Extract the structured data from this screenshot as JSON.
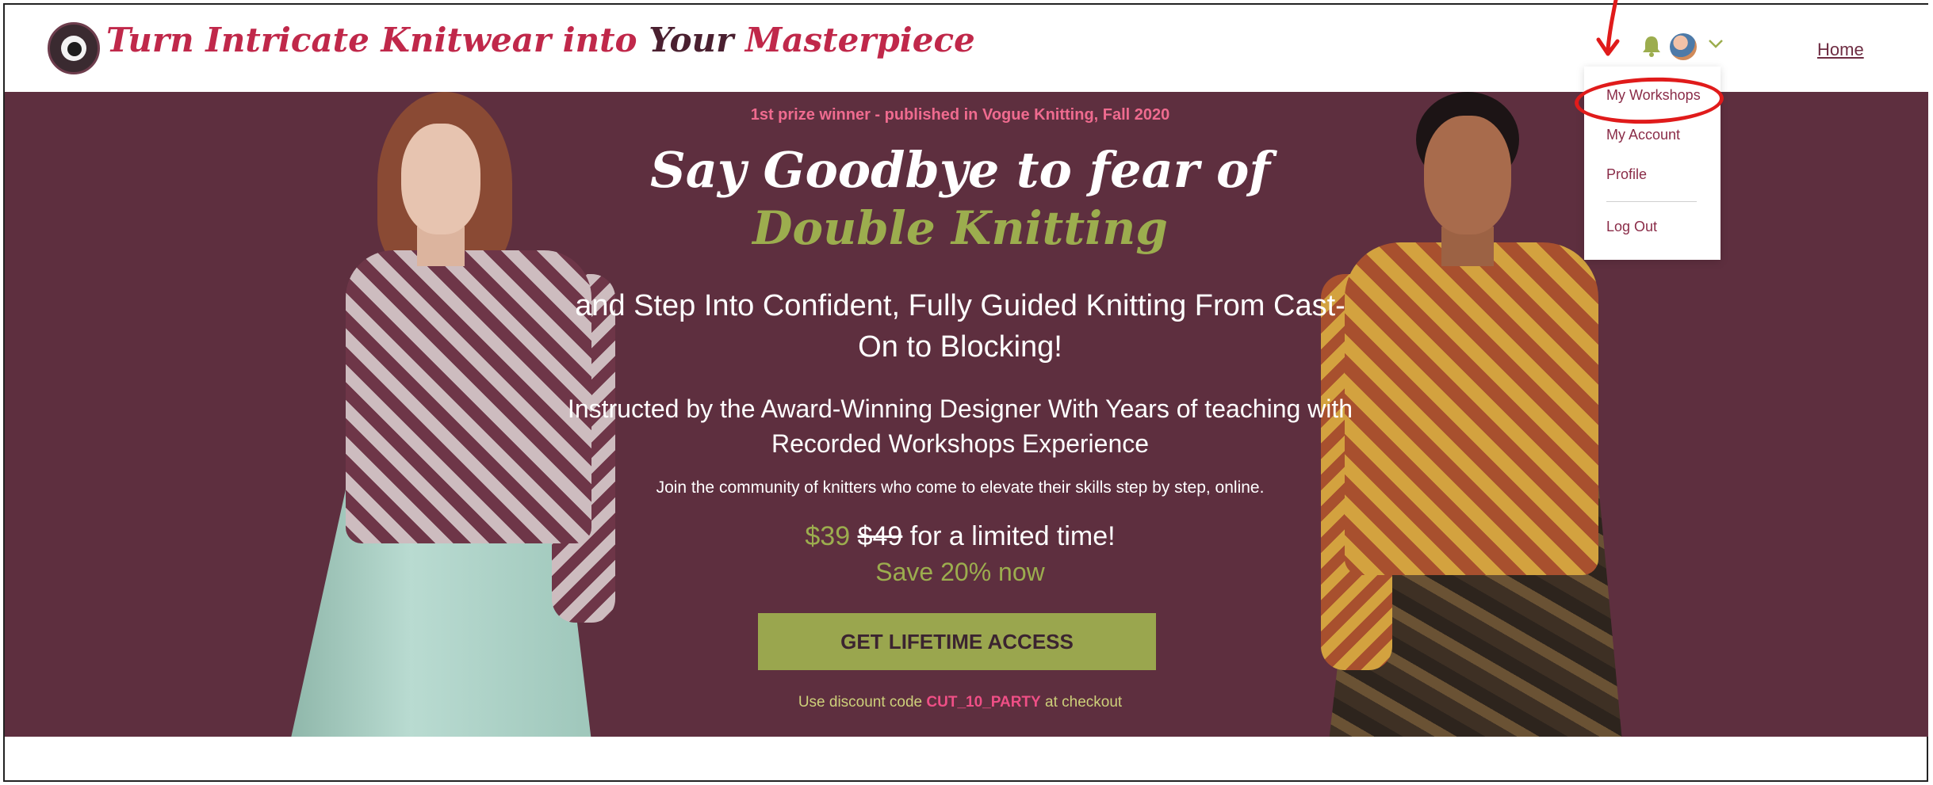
{
  "header": {
    "site_title_part1": "Turn Intricate Knitwear into ",
    "site_title_part2": "Your",
    "site_title_part3": " Masterpiece",
    "nav_home": "Home"
  },
  "dropdown": {
    "items": [
      "My Workshops",
      "My Account",
      "Profile",
      "Log Out"
    ]
  },
  "hero": {
    "tagline": "1st prize winner - published in Vogue Knitting, Fall 2020",
    "headline_line1": "Say Goodbye to fear of",
    "headline_line2": "Double Knitting",
    "subheadline": "and Step Into Confident, Fully Guided Knitting From Cast-On to Blocking!",
    "instructor": "Instructed by the Award-Winning Designer With Years of teaching with Recorded Workshops Experience",
    "community": "Join the community of knitters who come to elevate their skills step by step, online.",
    "price_new": "$39",
    "price_old": "$49",
    "price_suffix": "for a limited time!",
    "save_text": "Save 20% now",
    "cta_label": "GET LIFETIME ACCESS",
    "discount_prefix": "Use discount code ",
    "discount_code": "CUT_10_PARTY",
    "discount_suffix": " at checkout"
  },
  "colors": {
    "hero_bg": "#5e2f3f",
    "accent_green": "#9cad4e",
    "accent_pink": "#ef4f86",
    "title_red": "#c0284a",
    "annotation_red": "#e01b1b"
  },
  "icons": [
    "logo-badge",
    "bell-icon",
    "avatar",
    "chevron-down-icon"
  ]
}
